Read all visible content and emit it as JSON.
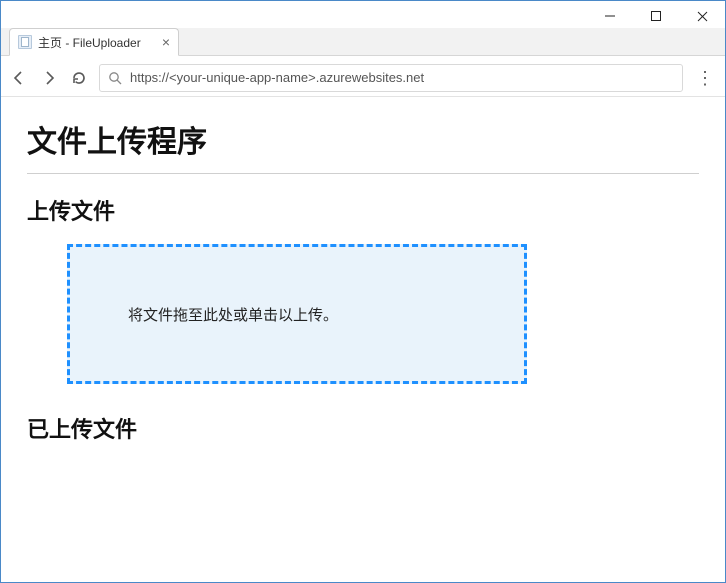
{
  "window": {
    "tab_title": "主页 - FileUploader"
  },
  "address_bar": {
    "url": "https://<your-unique-app-name>.azurewebsites.net"
  },
  "page": {
    "heading": "文件上传程序",
    "upload_section": {
      "title": "上传文件",
      "dropzone_text": "将文件拖至此处或单击以上传。"
    },
    "uploaded_section": {
      "title": "已上传文件"
    }
  }
}
